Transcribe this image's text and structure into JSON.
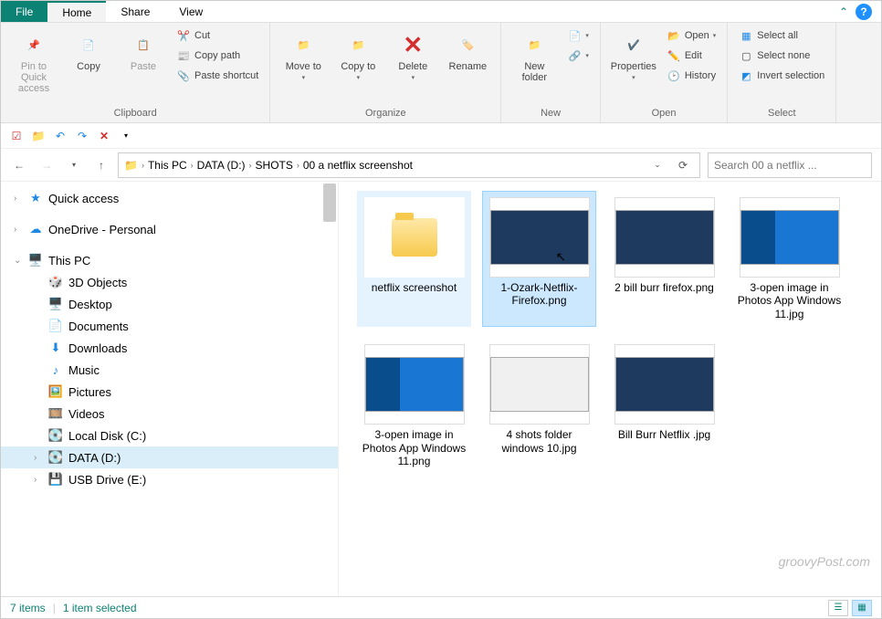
{
  "tabs": {
    "file": "File",
    "home": "Home",
    "share": "Share",
    "view": "View"
  },
  "ribbon": {
    "clipboard": {
      "label": "Clipboard",
      "pin": "Pin to Quick access",
      "copy": "Copy",
      "paste": "Paste",
      "cut": "Cut",
      "copypath": "Copy path",
      "pasteshort": "Paste shortcut"
    },
    "organize": {
      "label": "Organize",
      "moveto": "Move to",
      "copyto": "Copy to",
      "delete": "Delete",
      "rename": "Rename"
    },
    "new": {
      "label": "New",
      "newfolder": "New folder"
    },
    "open": {
      "label": "Open",
      "properties": "Properties",
      "open": "Open",
      "edit": "Edit",
      "history": "History"
    },
    "select": {
      "label": "Select",
      "selectall": "Select all",
      "selectnone": "Select none",
      "invert": "Invert selection"
    }
  },
  "breadcrumb": [
    "This PC",
    "DATA (D:)",
    "SHOTS",
    "00 a netflix screenshot"
  ],
  "search_placeholder": "Search 00 a netflix ...",
  "tree": {
    "quickaccess": "Quick access",
    "onedrive": "OneDrive - Personal",
    "thispc": "This PC",
    "children": [
      "3D Objects",
      "Desktop",
      "Documents",
      "Downloads",
      "Music",
      "Pictures",
      "Videos",
      "Local Disk (C:)",
      "DATA (D:)",
      "USB Drive (E:)"
    ]
  },
  "files": [
    {
      "name": "netflix screenshot",
      "type": "folder"
    },
    {
      "name": "1-Ozark-Netflix-Firefox.png",
      "type": "dark",
      "selected": true
    },
    {
      "name": "2 bill burr firefox.png",
      "type": "dark"
    },
    {
      "name": "3-open image in Photos App Windows 11.jpg",
      "type": "blue"
    },
    {
      "name": "3-open image in Photos App Windows 11.png",
      "type": "blue"
    },
    {
      "name": "4 shots folder windows 10.jpg",
      "type": "light"
    },
    {
      "name": "Bill Burr Netflix .jpg",
      "type": "dark"
    }
  ],
  "status": {
    "count": "7 items",
    "selected": "1 item selected"
  },
  "watermark": "groovyPost.com"
}
